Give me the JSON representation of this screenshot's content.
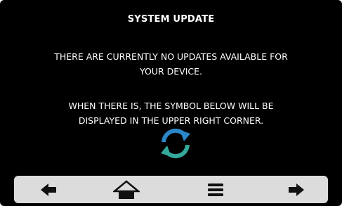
{
  "screen": {
    "title": "SYSTEM UPDATE",
    "message_line1": "THERE ARE CURRENTLY NO UPDATES AVAILABLE FOR",
    "message_line2": "YOUR DEVICE.",
    "message_line3": "WHEN THERE IS, THE SYMBOL BELOW WILL BE",
    "message_line4": "DISPLAYED IN THE UPPER RIGHT CORNER.",
    "symbol_icon": "sync-icon"
  },
  "nav": {
    "buttons": [
      {
        "icon": "arrow-left-icon"
      },
      {
        "icon": "home-icon"
      },
      {
        "icon": "menu-icon"
      },
      {
        "icon": "arrow-right-icon"
      }
    ]
  },
  "colors": {
    "background": "#000000",
    "text": "#ffffff",
    "navbar": "#dcdcdc",
    "nav_icon": "#111111",
    "sync_blue": "#2a86c7",
    "sync_teal": "#34a89a"
  }
}
